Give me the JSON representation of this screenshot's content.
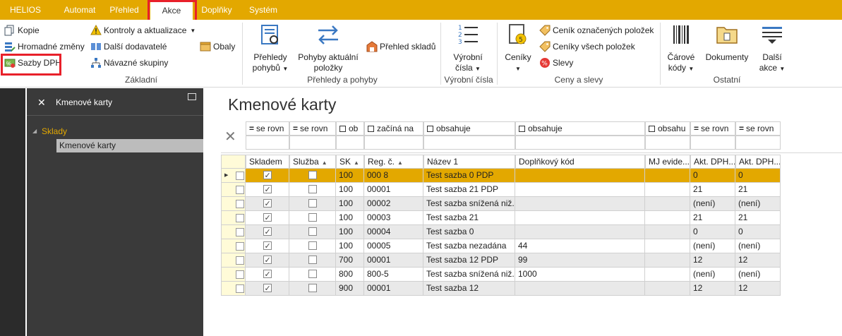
{
  "menu": {
    "items": [
      "HELIOS",
      "Automat",
      "Přehled",
      "Akce",
      "Doplňky",
      "Systém"
    ],
    "active_index": 3
  },
  "ribbon": {
    "zakladni": {
      "kopie": "Kopie",
      "hromadne": "Hromadné změny",
      "sazby": "Sazby DPH",
      "kontroly": "Kontroly a aktualizace",
      "dalsi_dodavatele": "Další dodavatelé",
      "navazne": "Návazné skupiny",
      "obaly": "Obaly",
      "label": "Základní"
    },
    "prehledy": {
      "prehledy_pohybu_1": "Přehledy",
      "prehledy_pohybu_2": "pohybů",
      "pohyby_1": "Pohyby aktuální",
      "pohyby_2": "položky",
      "prehled_skladu": "Přehled skladů",
      "label": "Přehledy a pohyby"
    },
    "vyrobni": {
      "btn_1": "Výrobní",
      "btn_2": "čísla",
      "label": "Výrobní čísla"
    },
    "ceny": {
      "ceniky": "Ceníky",
      "cenik_oznacenych": "Ceník označených položek",
      "ceniky_vsech": "Ceníky všech položek",
      "slevy": "Slevy",
      "label": "Ceny a slevy"
    },
    "ostatni": {
      "carove_1": "Čárové",
      "carove_2": "kódy",
      "dokumenty": "Dokumenty",
      "dalsi_1": "Další",
      "dalsi_2": "akce",
      "label": "Ostatní"
    }
  },
  "nav": {
    "title": "Kmenové karty",
    "tree_parent": "Sklady",
    "tree_child": "Kmenové karty"
  },
  "content": {
    "title": "Kmenové karty"
  },
  "filters": [
    {
      "op": "=",
      "text": "se rovn"
    },
    {
      "op": "=",
      "text": "se rovn"
    },
    {
      "op": "cb",
      "text": "ob"
    },
    {
      "op": "cb",
      "text": "začíná na"
    },
    {
      "op": "cb",
      "text": "obsahuje"
    },
    {
      "op": "cb",
      "text": "obsahuje"
    },
    {
      "op": "cb",
      "text": "obsahu"
    },
    {
      "op": "=",
      "text": "se rovn"
    },
    {
      "op": "=",
      "text": "se rovn"
    }
  ],
  "columns": [
    "Skladem",
    "Služba",
    "SK",
    "Reg. č.",
    "Název 1",
    "Doplňkový kód",
    "MJ evide...",
    "Akt. DPH...",
    "Akt. DPH..."
  ],
  "rows": [
    {
      "skladem": true,
      "sluzba": false,
      "sk": "100",
      "reg": "000 8",
      "nazev": "Test sazba 0 PDP",
      "dopl": "",
      "mj": "",
      "dph1": "0",
      "dph2": "0"
    },
    {
      "skladem": true,
      "sluzba": false,
      "sk": "100",
      "reg": "00001",
      "nazev": "Test sazba 21 PDP",
      "dopl": "",
      "mj": "",
      "dph1": "21",
      "dph2": "21"
    },
    {
      "skladem": true,
      "sluzba": false,
      "sk": "100",
      "reg": "00002",
      "nazev": "Test sazba snížená niž...",
      "dopl": "",
      "mj": "",
      "dph1": "(není)",
      "dph2": "(není)"
    },
    {
      "skladem": true,
      "sluzba": false,
      "sk": "100",
      "reg": "00003",
      "nazev": "Test sazba 21",
      "dopl": "",
      "mj": "",
      "dph1": "21",
      "dph2": "21"
    },
    {
      "skladem": true,
      "sluzba": false,
      "sk": "100",
      "reg": "00004",
      "nazev": "Test sazba 0",
      "dopl": "",
      "mj": "",
      "dph1": "0",
      "dph2": "0"
    },
    {
      "skladem": true,
      "sluzba": false,
      "sk": "100",
      "reg": "00005",
      "nazev": "Test sazba nezadána",
      "dopl": "44",
      "mj": "",
      "dph1": "(není)",
      "dph2": "(není)"
    },
    {
      "skladem": true,
      "sluzba": false,
      "sk": "700",
      "reg": "00001",
      "nazev": "Test sazba 12 PDP",
      "dopl": "99",
      "mj": "",
      "dph1": "12",
      "dph2": "12"
    },
    {
      "skladem": true,
      "sluzba": false,
      "sk": "800",
      "reg": "800-5",
      "nazev": "Test sazba snížená niž...",
      "dopl": "1000",
      "mj": "",
      "dph1": "(není)",
      "dph2": "(není)"
    },
    {
      "skladem": true,
      "sluzba": false,
      "sk": "900",
      "reg": "00001",
      "nazev": "Test sazba 12",
      "dopl": "",
      "mj": "",
      "dph1": "12",
      "dph2": "12"
    }
  ],
  "colors": {
    "accent": "#e3a800",
    "highlight_box": "#e8202a",
    "nav_bg": "#3a3a3a"
  }
}
